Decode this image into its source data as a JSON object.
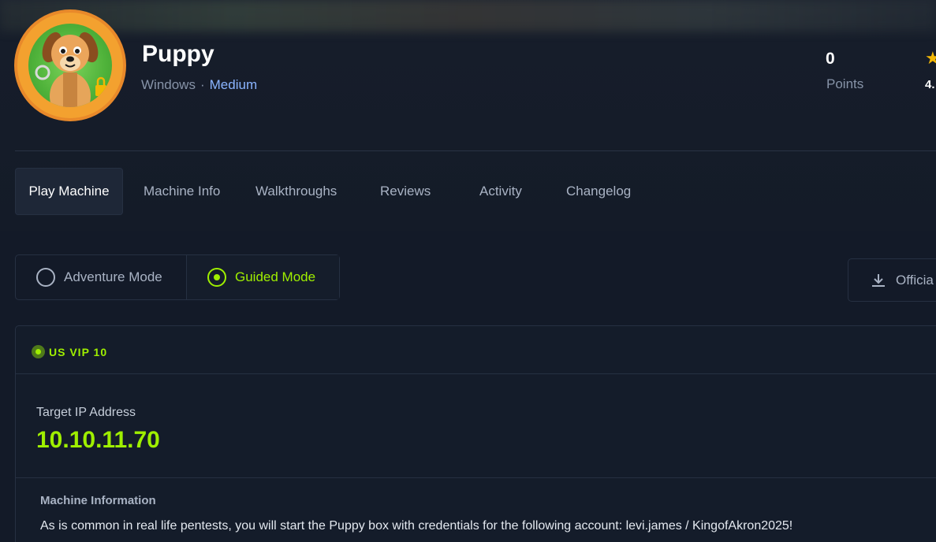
{
  "machine": {
    "name": "Puppy",
    "os": "Windows",
    "separator": "·",
    "difficulty": "Medium"
  },
  "stats": {
    "points_value": "0",
    "points_label": "Points",
    "rating_value": "4."
  },
  "tabs": [
    {
      "label": "Play Machine",
      "active": true
    },
    {
      "label": "Machine Info"
    },
    {
      "label": "Walkthroughs"
    },
    {
      "label": "Reviews"
    },
    {
      "label": "Activity"
    },
    {
      "label": "Changelog"
    }
  ],
  "modes": {
    "adventure": "Adventure Mode",
    "guided": "Guided Mode",
    "selected": "guided"
  },
  "download": {
    "label": "Officia"
  },
  "server": {
    "name": "US VIP 10"
  },
  "target": {
    "label": "Target IP Address",
    "ip": "10.10.11.70"
  },
  "info": {
    "title": "Machine Information",
    "text": "As is common in real life pentests, you will start the Puppy box with credentials for the following account: levi.james / KingofAkron2025!"
  },
  "colors": {
    "accent_green": "#9fef00",
    "difficulty_blue": "#8ab4ff",
    "star_yellow": "#f2b705",
    "avatar_orange": "#f3a12f"
  }
}
